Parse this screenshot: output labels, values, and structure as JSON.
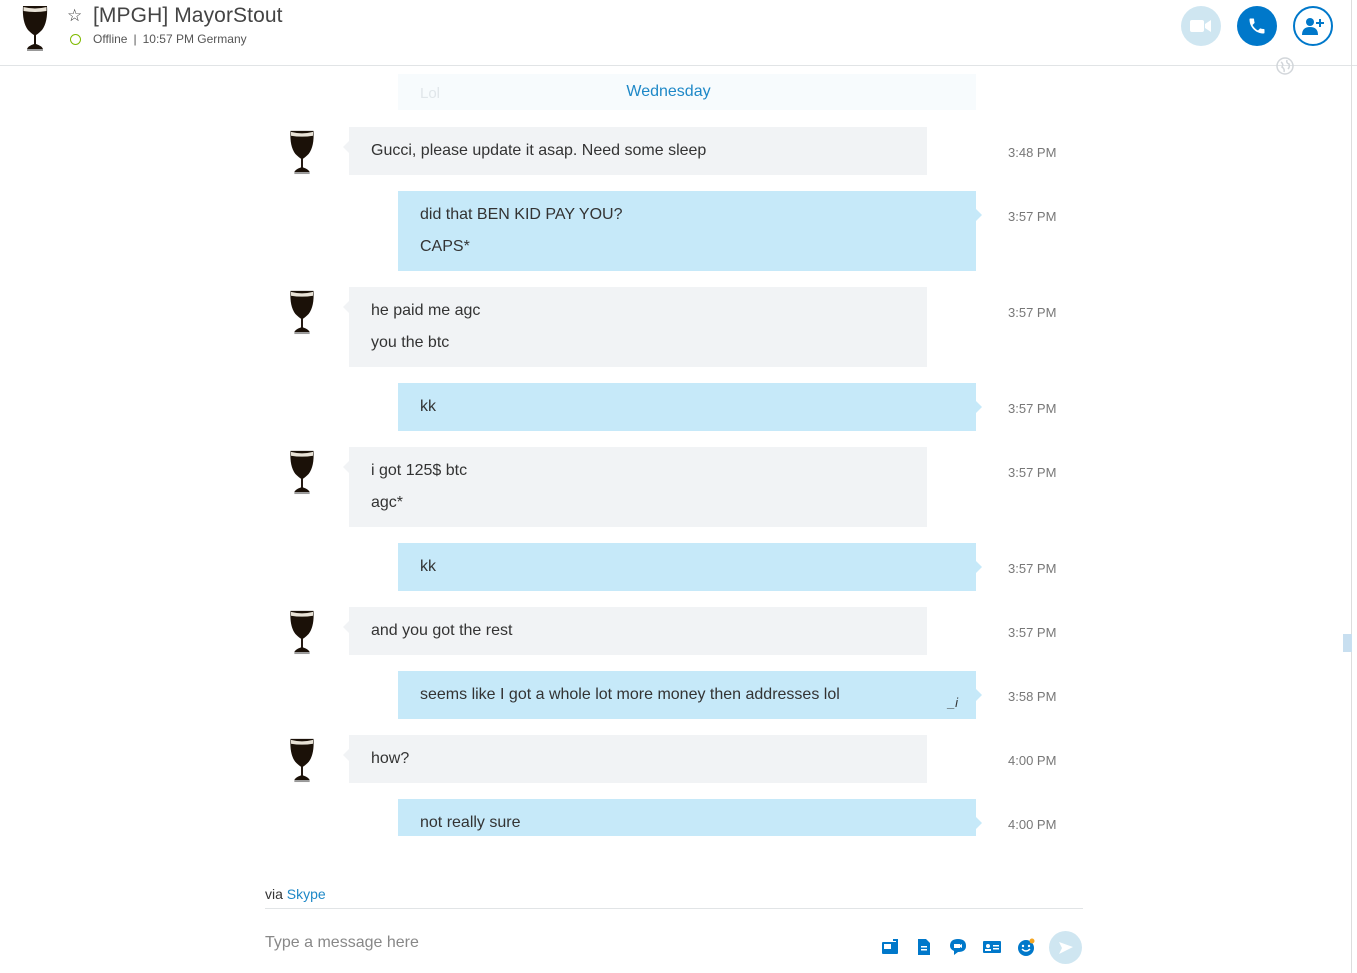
{
  "header": {
    "contact_name": "[MPGH] MayorStout",
    "status": "Offline",
    "separator": "|",
    "local_time": "10:57 PM Germany"
  },
  "chat": {
    "ghost_text": "Lol",
    "day_divider": "Wednesday",
    "messages": [
      {
        "dir": "in",
        "lines": [
          "Gucci, please update it asap. Need some sleep"
        ],
        "time": "3:48 PM"
      },
      {
        "dir": "out",
        "lines": [
          "did that BEN KID PAY YOU?",
          "CAPS*"
        ],
        "time": "3:57 PM"
      },
      {
        "dir": "in",
        "lines": [
          "he paid me agc",
          "you the btc"
        ],
        "time": "3:57 PM"
      },
      {
        "dir": "out",
        "lines": [
          "kk"
        ],
        "time": "3:57 PM"
      },
      {
        "dir": "in",
        "lines": [
          "i got 125$ btc",
          "agc*"
        ],
        "time": "3:57 PM"
      },
      {
        "dir": "out",
        "lines": [
          "kk"
        ],
        "time": "3:57 PM"
      },
      {
        "dir": "in",
        "lines": [
          "and you got the rest"
        ],
        "time": "3:57 PM"
      },
      {
        "dir": "out",
        "lines": [
          "seems like I got a whole lot more money then addresses lol"
        ],
        "time": "3:58 PM"
      },
      {
        "dir": "in",
        "lines": [
          "how?"
        ],
        "time": "4:00 PM"
      },
      {
        "dir": "out",
        "lines": [
          "not really sure"
        ],
        "time": "4:00 PM"
      }
    ]
  },
  "footer": {
    "via_prefix": "via",
    "via_link": "Skype",
    "composer_placeholder": "Type a message here"
  },
  "colors": {
    "accent": "#0078ca",
    "link": "#1e88c7",
    "incoming_bubble": "#f1f3f5",
    "outgoing_bubble": "#c6e9f9",
    "online_ring": "#7fba00"
  }
}
